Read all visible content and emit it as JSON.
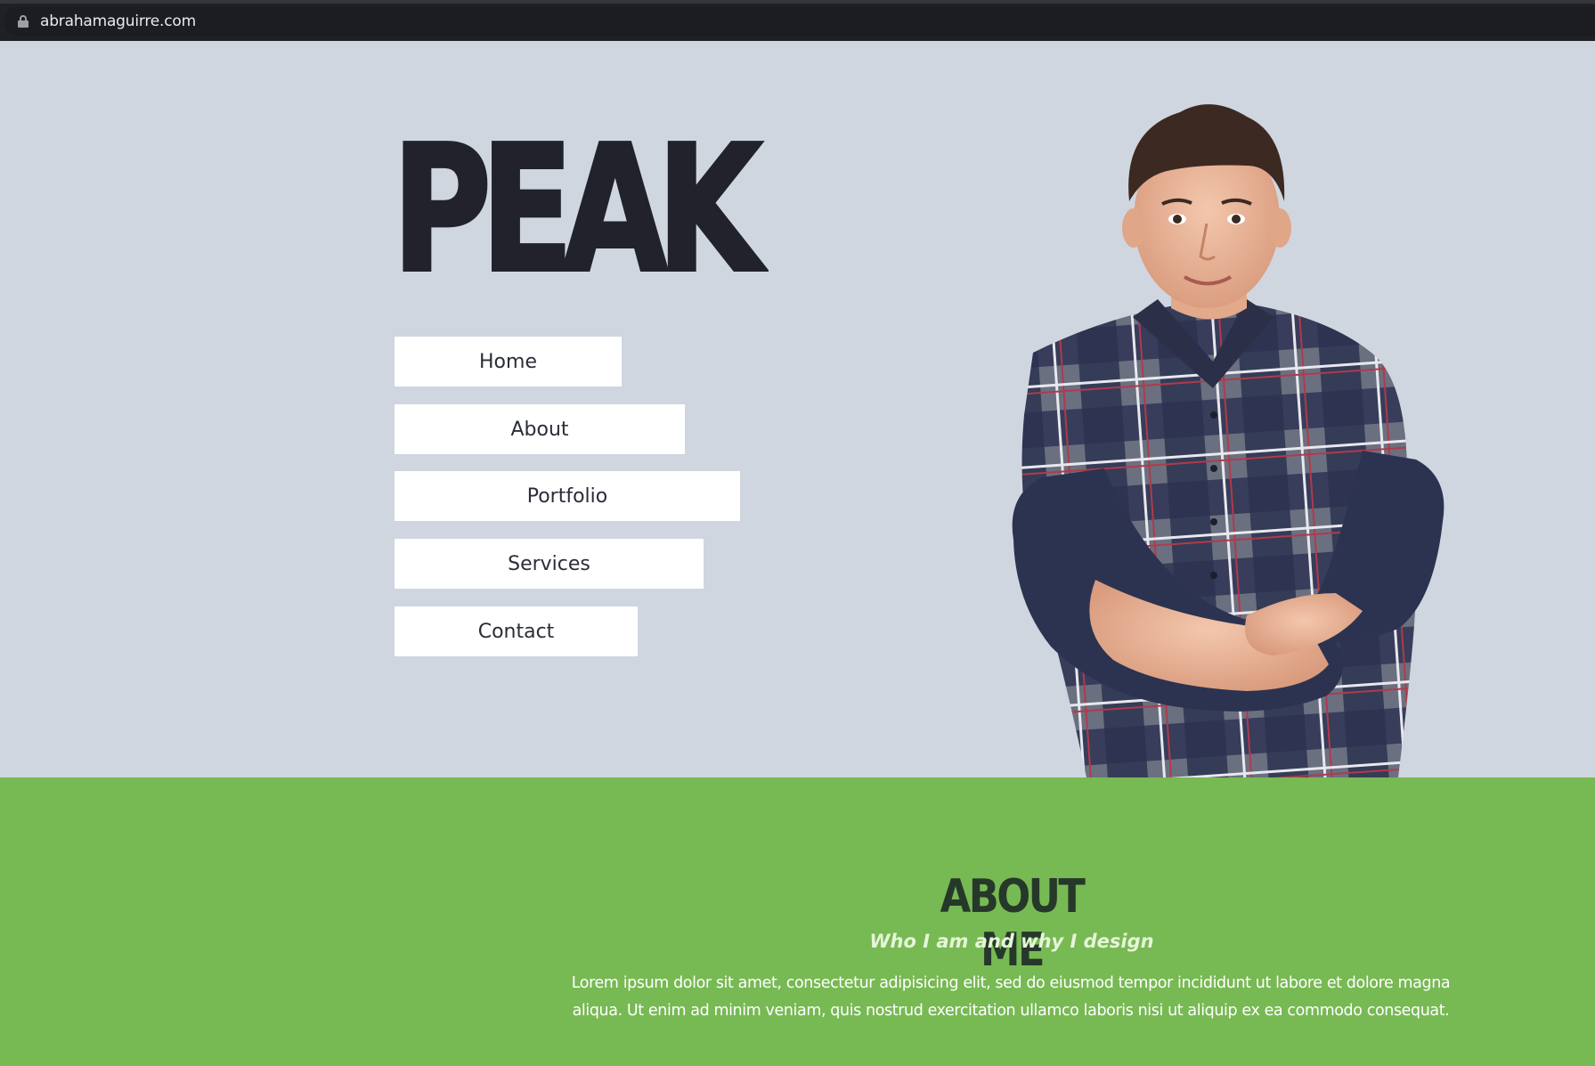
{
  "browser": {
    "url": "abrahamaguirre.com"
  },
  "hero": {
    "logo": "PEAK",
    "nav": [
      {
        "label": "Home"
      },
      {
        "label": "About"
      },
      {
        "label": "Portfolio"
      },
      {
        "label": "Services"
      },
      {
        "label": "Contact"
      }
    ]
  },
  "about": {
    "title": "ABOUT ME",
    "subtitle": "Who I am and why I design",
    "body": "Lorem ipsum dolor sit amet, consectetur adipisicing elit, sed do eiusmod tempor incididunt ut labore et dolore magna aliqua. Ut enim ad minim veniam, quis nostrud exercitation ullamco laboris nisi ut aliquip ex ea commodo consequat."
  },
  "colors": {
    "hero_bg": "#cfd6e0",
    "about_bg": "#77b953",
    "logo": "#21222b",
    "browser_bar": "#202124"
  }
}
